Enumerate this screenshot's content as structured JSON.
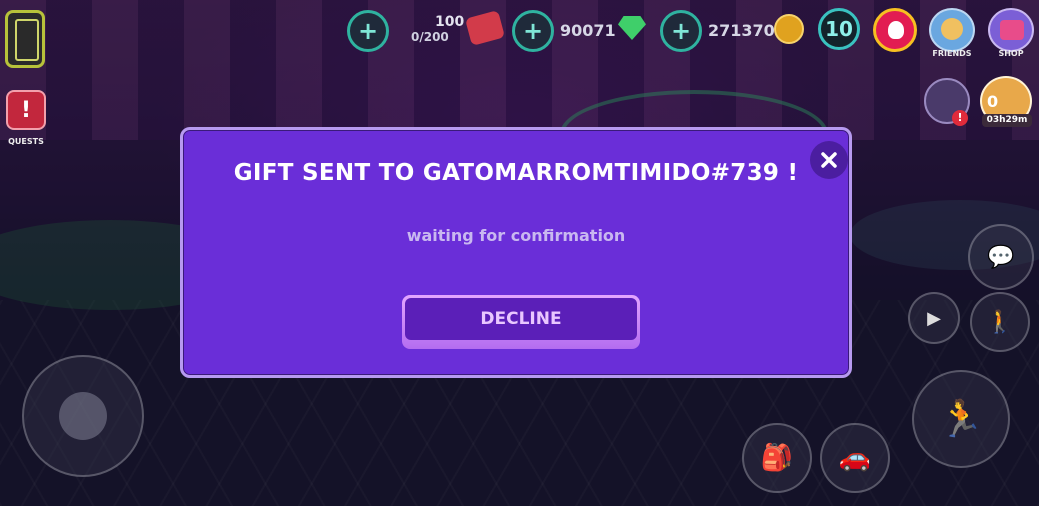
{
  "hud": {
    "level_badge": {
      "current": "100",
      "capacity": "0/200"
    },
    "gems": "90071",
    "coins": "271370",
    "level": "10",
    "friends_label": "FRIENDS",
    "shop_label": "SHOP",
    "quests_label": "QUESTS",
    "timer_count": "0",
    "timer": "03h29m"
  },
  "dialog": {
    "title": "GIFT SENT TO GATOMARROMTIMIDO#739 !",
    "subtitle": "waiting for confirmation",
    "decline_label": "DECLINE",
    "close_symbol": "✕"
  },
  "colors": {
    "dialog_bg": "#6a2ed8",
    "dialog_border": "#b79af0",
    "button_bg": "#5b1fb8",
    "accent_teal": "#2fb3a0"
  }
}
